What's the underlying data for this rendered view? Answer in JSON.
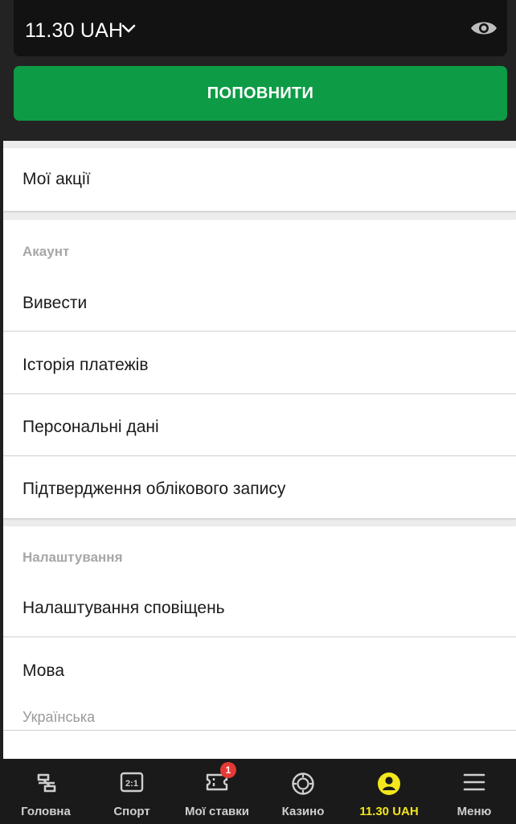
{
  "header": {
    "balance": "11.30 UAH",
    "topup_label": "ПОПОВНИТИ"
  },
  "menu": {
    "promotions": "Мої акції",
    "account_section": {
      "title": "Акаунт",
      "items": [
        "Вивести",
        "Історія платежів",
        "Персональні дані",
        "Підтвердження облікового запису"
      ]
    },
    "settings_section": {
      "title": "Налаштування",
      "notifications": "Налаштування сповіщень",
      "language_label": "Мова",
      "language_value": "Українська"
    }
  },
  "bottom_nav": {
    "items": [
      {
        "label": "Головна",
        "icon": "home-icon"
      },
      {
        "label": "Спорт",
        "icon": "sport-icon"
      },
      {
        "label": "Мої ставки",
        "icon": "ticket-icon",
        "badge": "1"
      },
      {
        "label": "Казино",
        "icon": "casino-chip-icon"
      },
      {
        "label": "11.30 UAH",
        "icon": "user-icon",
        "active": true
      },
      {
        "label": "Меню",
        "icon": "menu-icon"
      }
    ]
  },
  "colors": {
    "accent_green": "#0d9b46",
    "active_yellow": "#f3e61c",
    "badge_red": "#e53935"
  }
}
